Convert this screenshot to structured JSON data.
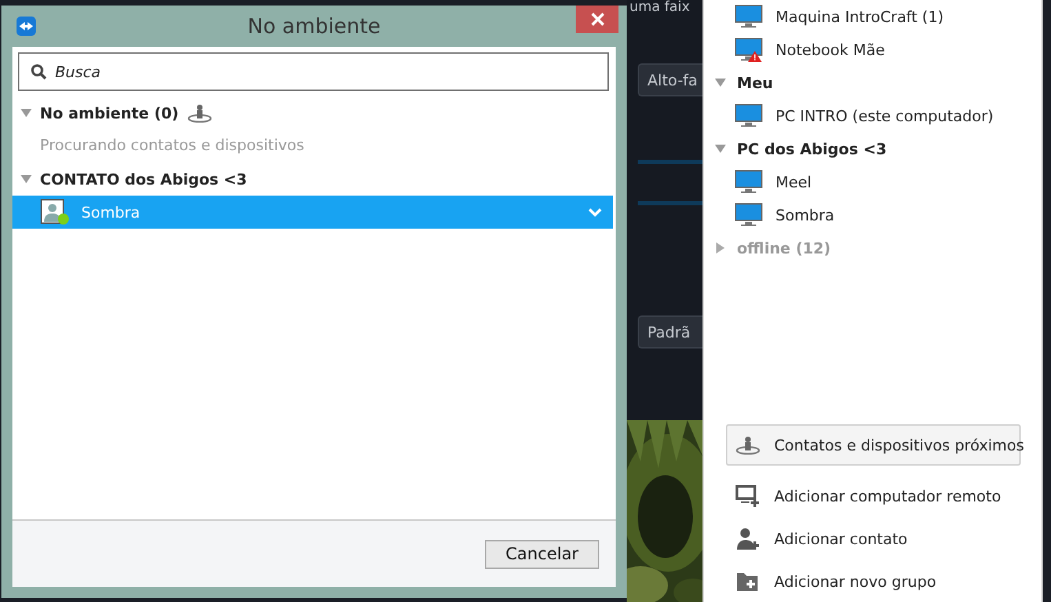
{
  "dialog": {
    "title": "No ambiente",
    "search": {
      "placeholder": "Busca"
    },
    "groups": [
      {
        "name": "No ambiente (0)",
        "expanded": true,
        "items": [
          {
            "kind": "message",
            "text": "Procurando contatos e dispositivos"
          }
        ]
      },
      {
        "name": "CONTATO dos Abigos <3",
        "expanded": true,
        "items": [
          {
            "kind": "contact",
            "name": "Sombra",
            "selected": true,
            "online": true
          }
        ]
      }
    ],
    "buttons": [
      "Cancelar"
    ]
  },
  "background_app": {
    "heading": "uma faix",
    "buttons": [
      "Alto-fa",
      "Padrã"
    ]
  },
  "contacts_panel": {
    "groups": [
      {
        "items": [
          {
            "name": "Maquina IntroCraft (1)",
            "warning": false
          },
          {
            "name": "Notebook Mãe",
            "warning": true
          }
        ]
      },
      {
        "name": "Meu",
        "expanded": true,
        "items": [
          {
            "name": "PC INTRO (este computador)",
            "warning": false
          }
        ]
      },
      {
        "name": "PC dos Abigos <3",
        "expanded": true,
        "items": [
          {
            "name": "Meel",
            "warning": false
          },
          {
            "name": "Sombra",
            "warning": false
          }
        ]
      },
      {
        "name": "offline (12)",
        "expanded": false
      }
    ],
    "actions": [
      {
        "kind": "nearby",
        "label": "Contatos e dispositivos próximos",
        "highlighted": true
      },
      {
        "kind": "add-computer",
        "label": "Adicionar computador remoto",
        "highlighted": false
      },
      {
        "kind": "add-contact",
        "label": "Adicionar contato",
        "highlighted": false
      },
      {
        "kind": "add-group",
        "label": "Adicionar novo grupo",
        "highlighted": false
      }
    ]
  }
}
